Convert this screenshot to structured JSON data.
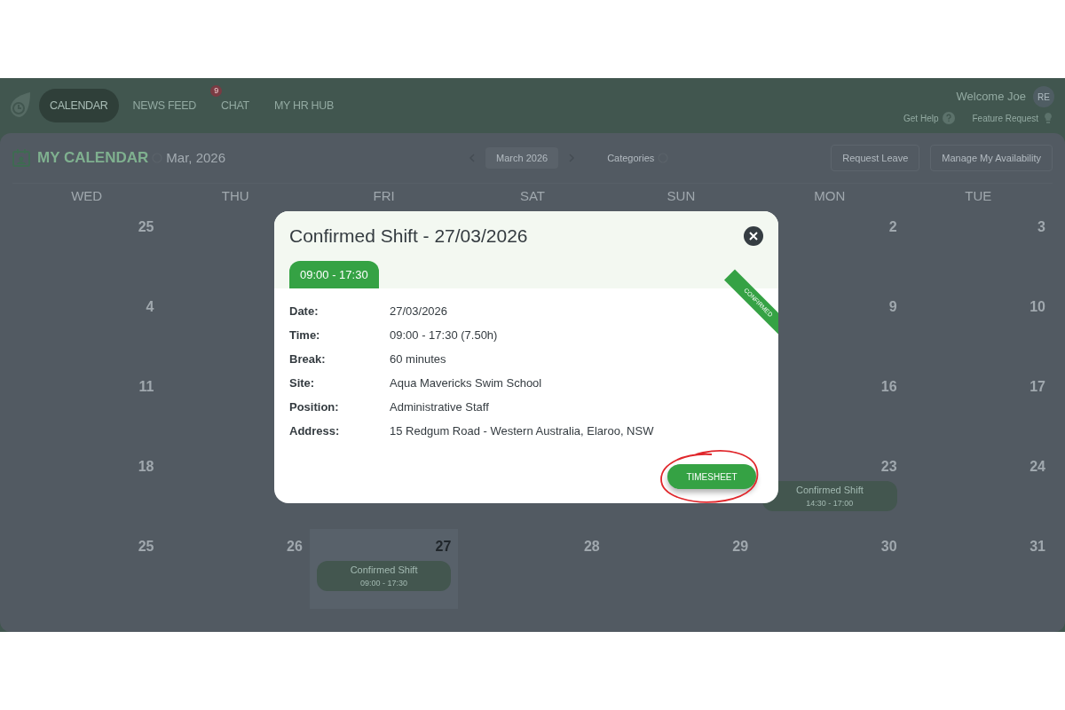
{
  "nav": {
    "items": [
      {
        "label": "CALENDAR",
        "selected": true
      },
      {
        "label": "NEWS FEED",
        "selected": false
      },
      {
        "label": "CHAT",
        "selected": false,
        "badge": "9"
      },
      {
        "label": "MY HR HUB",
        "selected": false
      }
    ],
    "welcome": "Welcome Joe",
    "avatar": "RE",
    "links": [
      {
        "label": "Get Help",
        "kind": "help"
      },
      {
        "label": "Feature Request",
        "kind": "idea"
      }
    ]
  },
  "toolbar": {
    "title": "MY CALENDAR",
    "month": "Mar, 2026",
    "picker": "March 2026",
    "categories": "Categories",
    "actions": [
      "Request Leave",
      "Manage My Availability"
    ]
  },
  "calendar": {
    "days": [
      "WED",
      "THU",
      "FRI",
      "SAT",
      "SUN",
      "MON",
      "TUE"
    ],
    "weeks": [
      {
        "left": [
          {
            "date": "25",
            "today": false
          }
        ],
        "right": [
          {
            "date": "2",
            "today": false
          },
          {
            "date": "3",
            "today": false
          }
        ]
      },
      {
        "left": [
          {
            "date": "4",
            "today": false
          }
        ],
        "right": [
          {
            "date": "9",
            "today": false
          },
          {
            "date": "10",
            "today": false
          }
        ]
      },
      {
        "left": [
          {
            "date": "11",
            "today": false
          }
        ],
        "right": [
          {
            "date": "16",
            "today": false
          },
          {
            "date": "17",
            "today": false
          }
        ]
      },
      {
        "left": [
          {
            "date": "18",
            "today": false
          }
        ],
        "right": [
          {
            "date": "23",
            "today": false,
            "event": {
              "title": "Confirmed Shift",
              "time": "14:30 - 17:00"
            }
          },
          {
            "date": "24",
            "today": false
          }
        ]
      },
      {
        "left": [
          {
            "date": "25",
            "today": false
          },
          {
            "date": "26",
            "today": false
          },
          {
            "date": "27",
            "today": true,
            "event": {
              "title": "Confirmed Shift",
              "time": "09:00 - 17:30"
            }
          },
          {
            "date": "28",
            "today": false
          },
          {
            "date": "29",
            "today": false
          },
          {
            "date": "30",
            "today": false
          },
          {
            "date": "31",
            "today": false
          }
        ]
      }
    ]
  },
  "modal": {
    "title": "Confirmed Shift - 27/03/2026",
    "time_tab": "09:00 - 17:30",
    "ribbon": "CONFIRMED",
    "details": [
      {
        "label": "Date:",
        "value": "27/03/2026"
      },
      {
        "label": "Time:",
        "value": "09:00 - 17:30 (7.50h)"
      },
      {
        "label": "Break:",
        "value": "60 minutes"
      },
      {
        "label": "Site:",
        "value": "Aqua Mavericks Swim School"
      },
      {
        "label": "Position:",
        "value": "Administrative Staff"
      },
      {
        "label": "Address:",
        "value": "15 Redgum Road - Western Australia, Elaroo, NSW"
      }
    ],
    "button": "TIMESHEET"
  }
}
